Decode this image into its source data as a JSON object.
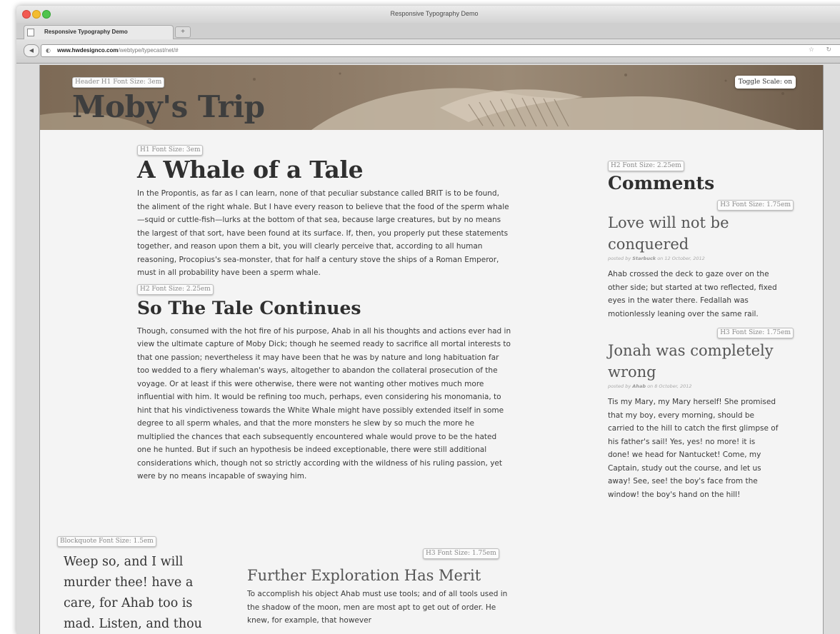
{
  "window": {
    "title": "Responsive Typography Demo"
  },
  "tab": {
    "label": "Responsive Typography Demo",
    "new_tab": "+"
  },
  "toolbar": {
    "url_host": "www.hwdesignco.com",
    "url_path": "/webtype/typecast/net/#"
  },
  "page": {
    "header_badge": "Header H1 Font Size: 3em",
    "toggle_label": "Toggle Scale: on",
    "site_title": "Moby's Trip",
    "main": {
      "h1_badge": "H1 Font Size: 3em",
      "h1": "A Whale of a Tale",
      "p1": "In the Propontis, as far as I can learn, none of that peculiar substance called BRIT is to be found, the aliment of the right whale. But I have every reason to believe that the food of the sperm whale—squid or cuttle-fish—lurks at the bottom of that sea, because large creatures, but by no means the largest of that sort, have been found at its surface. If, then, you properly put these statements together, and reason upon them a bit, you will clearly perceive that, according to all human reasoning, Procopius's sea-monster, that for half a century stove the ships of a Roman Emperor, must in all probability have been a sperm whale.",
      "h2_badge": "H2 Font Size: 2.25em",
      "h2": "So The Tale Continues",
      "p2": "Though, consumed with the hot fire of his purpose, Ahab in all his thoughts and actions ever had in view the ultimate capture of Moby Dick; though he seemed ready to sacrifice all mortal interests to that one passion; nevertheless it may have been that he was by nature and long habituation far too wedded to a fiery whaleman's ways, altogether to abandon the collateral prosecution of the voyage. Or at least if this were otherwise, there were not wanting other motives much more influential with him. It would be refining too much, perhaps, even considering his monomania, to hint that his vindictiveness towards the White Whale might have possibly extended itself in some degree to all sperm whales, and that the more monsters he slew by so much the more he multiplied the chances that each subsequently encountered whale would prove to be the hated one he hunted. But if such an hypothesis be indeed exceptionable, there were still additional considerations which, though not so strictly according with the wildness of his ruling passion, yet were by no means incapable of swaying him."
    },
    "blockquote_badge": "Blockquote Font Size: 1.5em",
    "blockquote": "Weep so, and I will murder thee! have a care, for Ahab too is mad. Listen, and thou",
    "further": {
      "badge": "H3 Font Size: 1.75em",
      "title": "Further Exploration Has Merit",
      "text": "To accomplish his object Ahab must use tools; and of all tools used in the shadow of the moon, men are most apt to get out of order. He knew, for example, that however"
    },
    "sidebar": {
      "h2_badge": "H2 Font Size: 2.25em",
      "h2": "Comments",
      "comments": [
        {
          "badge": "H3 Font Size: 1.75em",
          "title": "Love will not be conquered",
          "posted_by": "posted by",
          "author": "Starbuck",
          "date": "on 12 October, 2012",
          "text": "Ahab crossed the deck to gaze over on the other side; but started at two reflected, fixed eyes in the water there. Fedallah was motionlessly leaning over the same rail."
        },
        {
          "badge": "H3 Font Size: 1.75em",
          "title": "Jonah was completely wrong",
          "posted_by": "posted by",
          "author": "Ahab",
          "date": "on 8 October, 2012",
          "text": "Tis my Mary, my Mary herself! She promised that my boy, every morning, should be carried to the hill to catch the first glimpse of his father's sail! Yes, yes! no more! it is done! we head for Nantucket! Come, my Captain, study out the course, and let us away! See, see! the boy's face from the window! the boy's hand on the hill!"
        }
      ]
    }
  },
  "icons": [
    "favicon-icon",
    "back-arrow-icon",
    "globe-icon",
    "star-icon",
    "reload-icon",
    "whale-illustration"
  ],
  "colors": {
    "hero_tint": "#8c7965",
    "page_bg": "#f4f4f4",
    "heading": "#2f2f2f"
  }
}
